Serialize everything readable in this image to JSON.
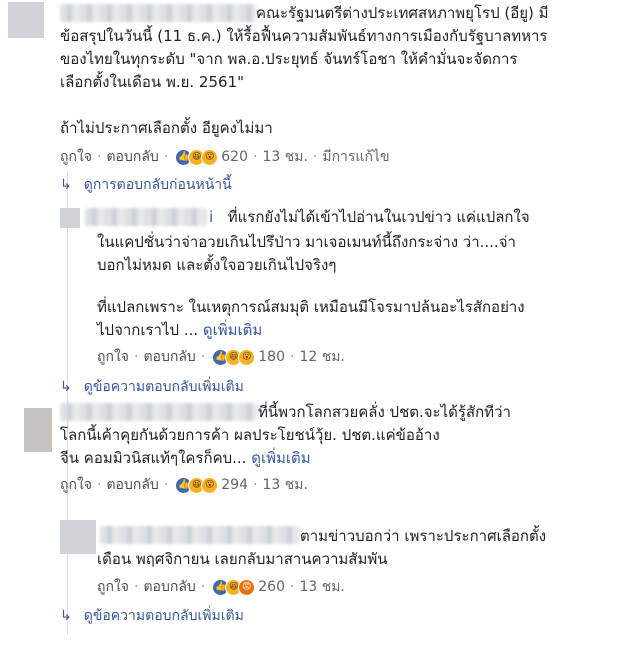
{
  "comments": [
    {
      "lines": [
        "คณะรัฐมนตรีต่างประเทศสหภาพยุโรป (อียู) มี",
        "ข้อสรุปในวันนี้ (11 ธ.ค.) ให้รื้อฟื้นความสัมพันธ์ทางการเมืองกับรัฐบาลทหาร",
        "ของไทยในทุกระดับ \"จาก พล.อ.ประยุทธ์ จันทร์โอชา ให้คำมั่นจะจัดการ",
        "เลือกตั้งในเดือน พ.ย. 2561\"",
        "ถ้าไม่ประกาศเลือกตั้ง อียูคงไม่มา"
      ],
      "like": "ถูกใจ",
      "reply": "ตอบกลับ",
      "reaction_icons": [
        "like-icon",
        "haha-icon",
        "wow-icon"
      ],
      "reaction_count": "620",
      "time": "13 ชม.",
      "edited": "มีการแก้ไข"
    },
    {
      "name_suffix": "i",
      "lines": [
        "ที่แรกยังไม่ได้เข้าไปอ่านในเวปข่าว แค่แปลกใจ",
        "ในแคปชั่นว่าจ่าอวยเกินไปรึป่าว มาเจอเมนท์นี้ถึงกระจ่าง ว่า....จ่า",
        "บอกไม่หมด และตั้งใจอวยเกินไปจริงๆ",
        "ที่แปลกเพราะ ในเหตุการณ์สมมุติ เหมือนมีโจรมาปล้นอะไรสักอย่าง",
        "ไปจากเราไป ..."
      ],
      "see_more": "ดูเพิ่มเติม",
      "like": "ถูกใจ",
      "reply": "ตอบกลับ",
      "reaction_icons": [
        "like-icon",
        "haha-icon",
        "wow-icon"
      ],
      "reaction_count": "180",
      "time": "12 ชม."
    },
    {
      "lines": [
        "ที่นี้พวกโลกสวยคลั่ง ปชต.จะได้รู้สักทีว่า",
        "โลกนี้เค้าคุยกันด้วยการค้า ผลประโยชน์วุ้ย. ปชต.แค่ข้ออ้าง",
        "จีน คอมมิวนิสแท้ๆใครก็คบ..."
      ],
      "see_more": "ดูเพิ่มเติม",
      "like": "ถูกใจ",
      "reply": "ตอบกลับ",
      "reaction_icons": [
        "like-icon",
        "haha-icon",
        "wow-icon"
      ],
      "reaction_count": "294",
      "time": "13 ชม."
    },
    {
      "lines": [
        "ตามข่าวบอกว่า เพราะประกาศเลือกตั้ง",
        "เดือน พฤศจิกายน เลยกลับมาสานความสัมพัน"
      ],
      "like": "ถูกใจ",
      "reply": "ตอบกลับ",
      "reaction_icons": [
        "like-icon",
        "haha-icon",
        "angry-icon"
      ],
      "reaction_count": "260",
      "time": "13 ชม."
    }
  ],
  "links": {
    "previous_replies": "ดูการตอบกลับก่อนหน้านี้",
    "more_replies_1": "ดูข้อความตอบกลับเพิ่มเติม",
    "more_replies_2": "ดูข้อความตอบกลับเพิ่มเติม"
  },
  "colors": {
    "link": "#365899",
    "meta": "#606770",
    "like_blue": "#4267b2",
    "emoji_yellow": "#f7b125"
  }
}
